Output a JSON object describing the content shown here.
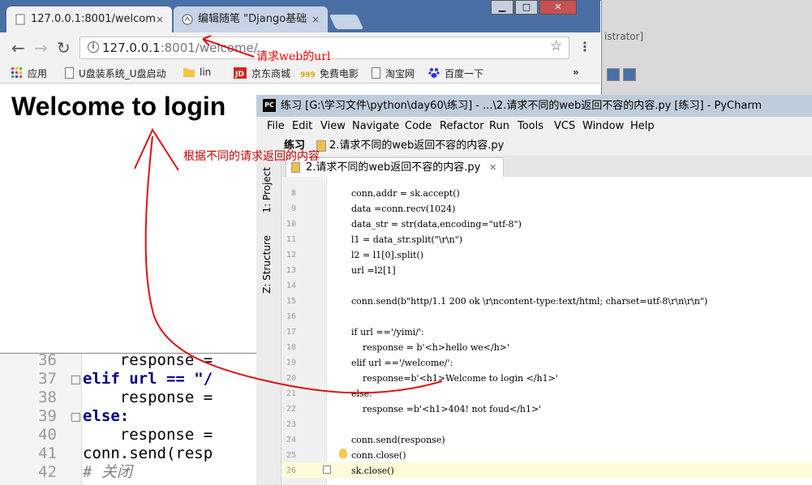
{
  "bg_editor": {
    "right_text": "istrator]",
    "lines": [
      {
        "num": "36",
        "code": "    response ="
      },
      {
        "num": "37",
        "code": "elif url == \"/"
      },
      {
        "num": "38",
        "code": "    response ="
      },
      {
        "num": "39",
        "code": "else:"
      },
      {
        "num": "40",
        "code": "    response ="
      },
      {
        "num": "41",
        "code": "conn.send(resp"
      },
      {
        "num": "42",
        "code": "# 关闭"
      }
    ]
  },
  "chrome": {
    "tabs": [
      {
        "label": "127.0.0.1:8001/welcom",
        "close": "×"
      },
      {
        "label": "编辑随笔 \"Django基础",
        "close": "×"
      }
    ],
    "window_controls": {
      "minimize": "▁",
      "maximize": "□",
      "close": "✕"
    },
    "nav": {
      "back": "←",
      "forward": "→",
      "reload": "↻"
    },
    "address": {
      "host": "127.0.0.1",
      "rest": ":8001/welcome/"
    },
    "star": "☆",
    "menu": "⋮",
    "bookmarks": [
      "应用",
      "U盘装系统_U盘启动",
      "lin",
      "京东商城",
      "免费电影",
      "淘宝网",
      "百度一下"
    ],
    "bookmarks_more": "»",
    "page_heading": "Welcome to login"
  },
  "pycharm": {
    "title": "练习 [G:\\学习文件\\python\\day60\\练习] - ...\\2.请求不同的web返回不容的内容.py [练习] - PyCharm",
    "menus": [
      "File",
      "Edit",
      "View",
      "Navigate",
      "Code",
      "Refactor",
      "Run",
      "Tools",
      "VCS",
      "Window",
      "Help"
    ],
    "breadcrumb_project": "练习",
    "breadcrumb_file": "2.请求不同的web返回不容的内容.py",
    "tool_project": "1: Project",
    "tool_structure": "Z: Structure",
    "file_tab": "2.请求不同的web返回不容的内容.py",
    "lines": [
      {
        "num": "8",
        "code": "conn,addr = sk.accept()"
      },
      {
        "num": "9",
        "code": "data =conn.recv(1024)"
      },
      {
        "num": "10",
        "code": "data_str = str(data,encoding=\"utf-8\")"
      },
      {
        "num": "11",
        "code": "l1 = data_str.split(\"\\r\\n\")"
      },
      {
        "num": "12",
        "code": "l2 = l1[0].split()"
      },
      {
        "num": "13",
        "code": "url =l2[1]"
      },
      {
        "num": "14",
        "code": ""
      },
      {
        "num": "15",
        "code": "conn.send(b\"http/1.1 200 ok \\r\\ncontent-type:text/html; charset=utf-8\\r\\n\\r\\n\")"
      },
      {
        "num": "16",
        "code": ""
      },
      {
        "num": "17",
        "code": "if url =='/yimi/':"
      },
      {
        "num": "18",
        "code": "    response = b'<h>hello we</h>'"
      },
      {
        "num": "19",
        "code": "elif url =='/welcome/':"
      },
      {
        "num": "20",
        "code": "    response=b'<h1>Welcome to login </h1>'"
      },
      {
        "num": "21",
        "code": "else:"
      },
      {
        "num": "22",
        "code": "    response =b'<h1>404! not foud</h1>'"
      },
      {
        "num": "23",
        "code": ""
      },
      {
        "num": "24",
        "code": "conn.send(response)"
      },
      {
        "num": "25",
        "code": "conn.close()"
      },
      {
        "num": "26",
        "code": "sk.close()"
      }
    ]
  },
  "annotations": {
    "url_note": "请求web的url",
    "content_note": "根据不同的请求返回的内容"
  },
  "colors": {
    "annotation_red": "#ff0000",
    "chrome_frame": "#4a6fa5",
    "pycharm_title": "#bfcddb"
  }
}
